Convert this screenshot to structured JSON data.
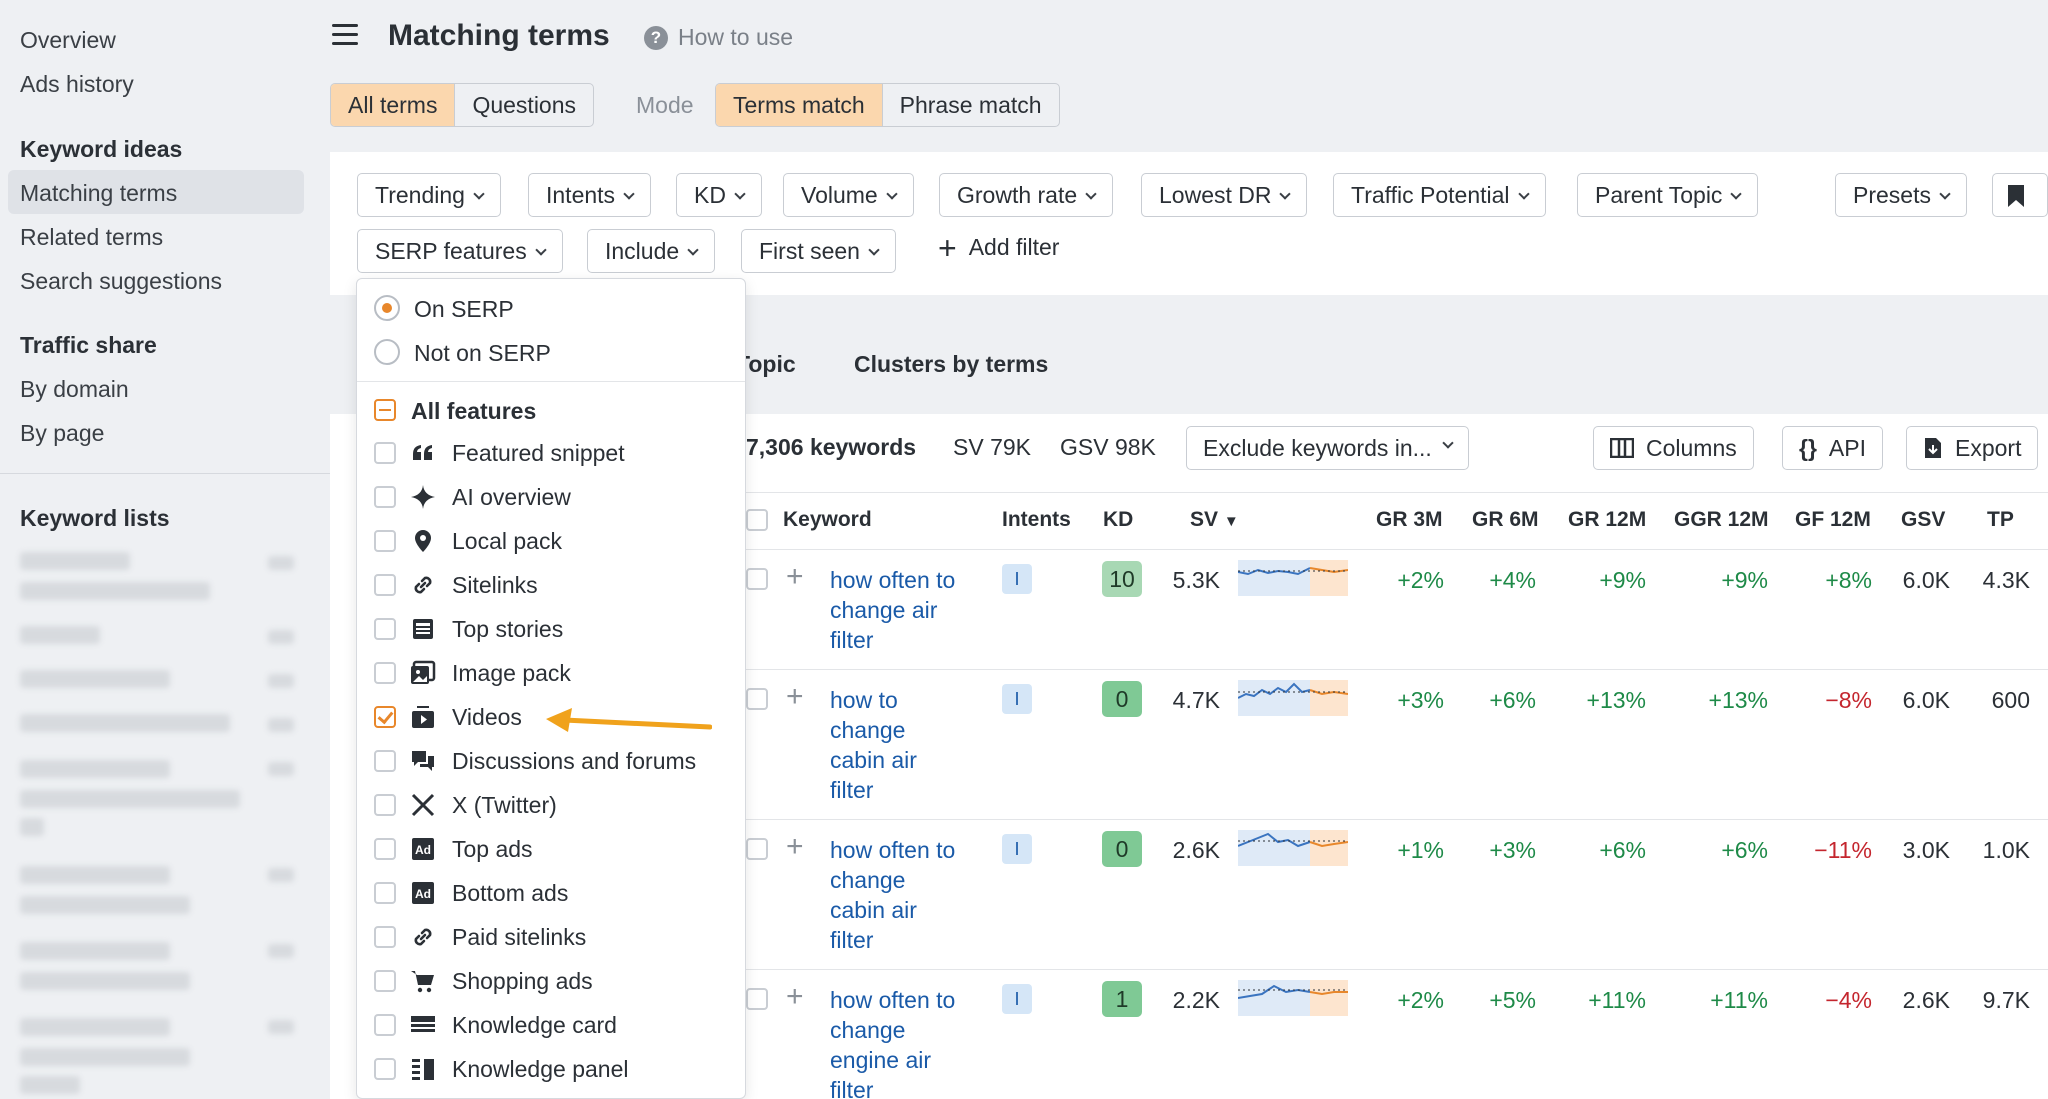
{
  "sidebar": {
    "overview": "Overview",
    "ads_history": "Ads history",
    "keyword_ideas_heading": "Keyword ideas",
    "matching_terms": "Matching terms",
    "related_terms": "Related terms",
    "search_suggestions": "Search suggestions",
    "traffic_share_heading": "Traffic share",
    "by_domain": "By domain",
    "by_page": "By page",
    "keyword_lists_heading": "Keyword lists"
  },
  "header": {
    "title": "Matching terms",
    "how_to_use": "How to use",
    "scope_tabs": [
      "All terms",
      "Questions"
    ],
    "mode_label": "Mode",
    "mode_tabs": [
      "Terms match",
      "Phrase match"
    ]
  },
  "filters": {
    "row1": [
      "Trending",
      "Intents",
      "KD",
      "Volume",
      "Growth rate",
      "Lowest DR",
      "Traffic Potential",
      "Parent Topic"
    ],
    "presets": "Presets",
    "row2": [
      "SERP features",
      "Include",
      "First seen"
    ],
    "add_filter": "Add filter"
  },
  "tabs": {
    "parent_topic_partial": "Topic",
    "clusters_by_terms": "Clusters by terms"
  },
  "stats": {
    "keywords": "7,306 keywords",
    "sv": "SV 79K",
    "gsv": "GSV 98K",
    "exclude": "Exclude keywords in...",
    "columns": "Columns",
    "api": "API",
    "export": "Export"
  },
  "table": {
    "headers": {
      "keyword": "Keyword",
      "intents": "Intents",
      "kd": "KD",
      "sv": "SV",
      "gr3m": "GR 3M",
      "gr6m": "GR 6M",
      "gr12m": "GR 12M",
      "ggr12m": "GGR 12M",
      "gf12m": "GF 12M",
      "gsv": "GSV",
      "tp": "TP"
    },
    "rows": [
      {
        "kw1": "how often to",
        "kw2": "change air",
        "kw3": "filter",
        "kw4": "",
        "intent": "I",
        "kd": "10",
        "kd_color": "#a8d8b4",
        "sv": "5.3K",
        "gr3m": "+2%",
        "gr6m": "+4%",
        "gr12m": "+9%",
        "ggr12m": "+9%",
        "gf12m": "+8%",
        "gsv": "6.0K",
        "tp": "4.3K"
      },
      {
        "kw1": "how to",
        "kw2": "change",
        "kw3": "cabin air",
        "kw4": "filter",
        "intent": "I",
        "kd": "0",
        "kd_color": "#7fc995",
        "sv": "4.7K",
        "gr3m": "+3%",
        "gr6m": "+6%",
        "gr12m": "+13%",
        "ggr12m": "+13%",
        "gf12m": "−8%",
        "gsv": "6.0K",
        "tp": "600"
      },
      {
        "kw1": "how often to",
        "kw2": "change",
        "kw3": "cabin air",
        "kw4": "filter",
        "intent": "I",
        "kd": "0",
        "kd_color": "#7fc995",
        "sv": "2.6K",
        "gr3m": "+1%",
        "gr6m": "+3%",
        "gr12m": "+6%",
        "ggr12m": "+6%",
        "gf12m": "−11%",
        "gsv": "3.0K",
        "tp": "1.0K"
      },
      {
        "kw1": "how often to",
        "kw2": "change",
        "kw3": "engine air",
        "kw4": "filter",
        "intent": "I",
        "kd": "1",
        "kd_color": "#7fc995",
        "sv": "2.2K",
        "gr3m": "+2%",
        "gr6m": "+5%",
        "gr12m": "+11%",
        "ggr12m": "+11%",
        "gf12m": "−4%",
        "gsv": "2.6K",
        "tp": "9.7K"
      }
    ]
  },
  "serp_dropdown": {
    "on_serp": "On SERP",
    "not_on_serp": "Not on SERP",
    "all_features": "All features",
    "features": [
      {
        "label": "Featured snippet",
        "icon": "quote-icon",
        "checked": false
      },
      {
        "label": "AI overview",
        "icon": "sparkle-icon",
        "checked": false
      },
      {
        "label": "Local pack",
        "icon": "map-pin-icon",
        "checked": false
      },
      {
        "label": "Sitelinks",
        "icon": "link-icon",
        "checked": false
      },
      {
        "label": "Top stories",
        "icon": "newspaper-icon",
        "checked": false
      },
      {
        "label": "Image pack",
        "icon": "image-icon",
        "checked": false
      },
      {
        "label": "Videos",
        "icon": "video-icon",
        "checked": true
      },
      {
        "label": "Discussions and forums",
        "icon": "chat-icon",
        "checked": false
      },
      {
        "label": "X (Twitter)",
        "icon": "x-logo-icon",
        "checked": false
      },
      {
        "label": "Top ads",
        "icon": "ad-icon",
        "checked": false
      },
      {
        "label": "Bottom ads",
        "icon": "ad-icon",
        "checked": false
      },
      {
        "label": "Paid sitelinks",
        "icon": "link-icon",
        "checked": false
      },
      {
        "label": "Shopping ads",
        "icon": "cart-icon",
        "checked": false
      },
      {
        "label": "Knowledge card",
        "icon": "card-icon",
        "checked": false
      },
      {
        "label": "Knowledge panel",
        "icon": "panel-icon",
        "checked": false
      }
    ]
  },
  "colors": {
    "accent_orange": "#e8872b",
    "active_tab": "#fbd7ae",
    "link_blue": "#1a5aa8",
    "positive": "#1e8a48",
    "negative": "#c4262e"
  }
}
